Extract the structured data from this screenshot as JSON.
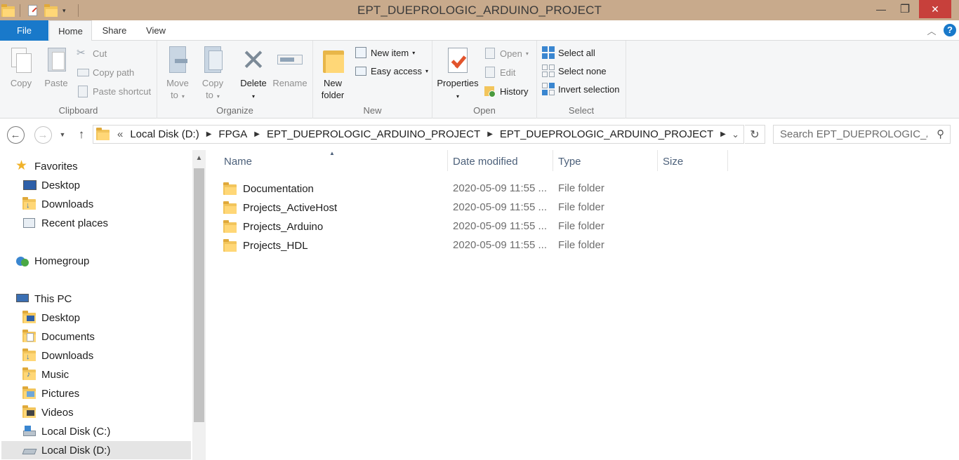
{
  "window": {
    "title": "EPT_DUEPROLOGIC_ARDUINO_PROJECT",
    "minimize_glyph": "—",
    "maximize_glyph": "❐",
    "close_glyph": "✕"
  },
  "ribbon_tabs": {
    "file": "File",
    "home": "Home",
    "share": "Share",
    "view": "View"
  },
  "ribbon": {
    "clipboard": {
      "label": "Clipboard",
      "copy": "Copy",
      "paste": "Paste",
      "cut": "Cut",
      "copy_path": "Copy path",
      "paste_shortcut": "Paste shortcut"
    },
    "organize": {
      "label": "Organize",
      "move_to_1": "Move",
      "move_to_2": "to",
      "copy_to_1": "Copy",
      "copy_to_2": "to",
      "delete": "Delete",
      "rename": "Rename"
    },
    "new": {
      "label": "New",
      "new_folder_1": "New",
      "new_folder_2": "folder",
      "new_item": "New item",
      "easy_access": "Easy access"
    },
    "open": {
      "label": "Open",
      "properties": "Properties",
      "open": "Open",
      "edit": "Edit",
      "history": "History"
    },
    "select": {
      "label": "Select",
      "select_all": "Select all",
      "select_none": "Select none",
      "invert_selection": "Invert selection"
    }
  },
  "address": {
    "overflow": "«",
    "crumbs": [
      "Local Disk (D:)",
      "FPGA",
      "EPT_DUEPROLOGIC_ARDUINO_PROJECT",
      "EPT_DUEPROLOGIC_ARDUINO_PROJECT"
    ],
    "search_placeholder": "Search EPT_DUEPROLOGIC_AR..."
  },
  "nav_pane": {
    "favorites": "Favorites",
    "fav_desktop": "Desktop",
    "fav_downloads": "Downloads",
    "fav_recent": "Recent places",
    "homegroup": "Homegroup",
    "this_pc": "This PC",
    "pc_desktop": "Desktop",
    "pc_documents": "Documents",
    "pc_downloads": "Downloads",
    "pc_music": "Music",
    "pc_pictures": "Pictures",
    "pc_videos": "Videos",
    "disk_c": "Local Disk (C:)",
    "disk_d": "Local Disk (D:)"
  },
  "columns": {
    "name": "Name",
    "date": "Date modified",
    "type": "Type",
    "size": "Size"
  },
  "files": [
    {
      "name": "Documentation",
      "date": "2020-05-09 11:55 ...",
      "type": "File folder",
      "size": ""
    },
    {
      "name": "Projects_ActiveHost",
      "date": "2020-05-09 11:55 ...",
      "type": "File folder",
      "size": ""
    },
    {
      "name": "Projects_Arduino",
      "date": "2020-05-09 11:55 ...",
      "type": "File folder",
      "size": ""
    },
    {
      "name": "Projects_HDL",
      "date": "2020-05-09 11:55 ...",
      "type": "File folder",
      "size": ""
    }
  ],
  "colors": {
    "title_bar": "#c8aa8c",
    "file_tab": "#1979ca",
    "close_button": "#c7403b",
    "folder": "#f2c55c"
  }
}
